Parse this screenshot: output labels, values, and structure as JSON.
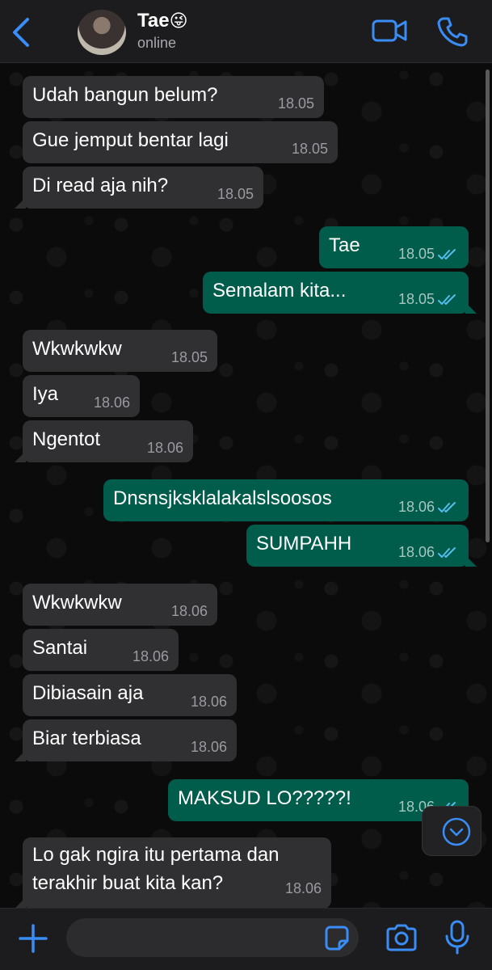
{
  "header": {
    "name": "Tae",
    "name_emoji": "😜",
    "status": "online"
  },
  "messages": [
    {
      "dir": "in",
      "text": "Udah bangun belum?",
      "time": "18.05"
    },
    {
      "dir": "in",
      "text": "Gue jemput bentar lagi",
      "time": "18.05"
    },
    {
      "dir": "in",
      "text": "Di read aja nih?",
      "time": "18.05"
    },
    {
      "dir": "out",
      "text": "Tae",
      "time": "18.05"
    },
    {
      "dir": "out",
      "text": "Semalam kita...",
      "time": "18.05"
    },
    {
      "dir": "in",
      "text": "Wkwkwkw",
      "time": "18.05"
    },
    {
      "dir": "in",
      "text": "Iya",
      "time": "18.06"
    },
    {
      "dir": "in",
      "text": "Ngentot",
      "time": "18.06"
    },
    {
      "dir": "out",
      "text": "Dnsnsjksklalakalslsoosos",
      "time": "18.06"
    },
    {
      "dir": "out",
      "text": "SUMPAHH",
      "time": "18.06"
    },
    {
      "dir": "in",
      "text": "Wkwkwkw",
      "time": "18.06"
    },
    {
      "dir": "in",
      "text": "Santai",
      "time": "18.06"
    },
    {
      "dir": "in",
      "text": "Dibiasain aja",
      "time": "18.06"
    },
    {
      "dir": "in",
      "text": "Biar terbiasa",
      "time": "18.06"
    },
    {
      "dir": "out",
      "text": "MAKSUD LO?????!",
      "time": "18.06"
    },
    {
      "dir": "in",
      "text": "Lo gak ngira itu pertama dan terakhir buat kita kan?",
      "time": "18.06"
    }
  ],
  "composer": {
    "placeholder": ""
  },
  "colors": {
    "accent": "#3a8df5",
    "incoming_bubble": "#303033",
    "outgoing_bubble": "#005c4b",
    "read_ticks": "#53bdeb"
  },
  "icons": [
    "back-chevron-icon",
    "video-call-icon",
    "phone-icon",
    "read-ticks-icon",
    "chevron-down-icon",
    "plus-icon",
    "sticker-icon",
    "camera-icon",
    "microphone-icon"
  ]
}
